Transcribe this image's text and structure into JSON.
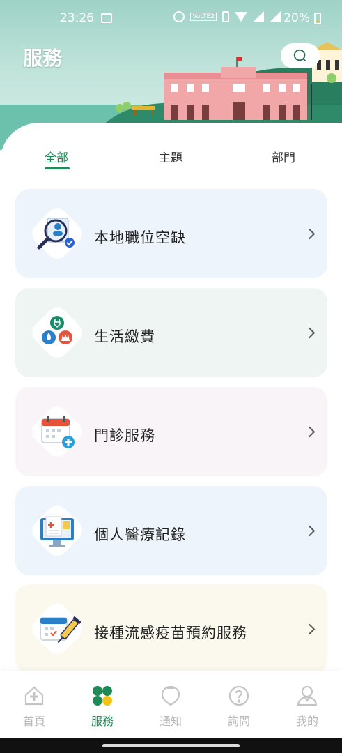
{
  "status_bar": {
    "time": "23:26",
    "battery": "20%",
    "volte": "VoLTE2"
  },
  "header": {
    "title": "服務",
    "search_icon": "search-icon"
  },
  "tabs": [
    {
      "label": "全部",
      "active": true
    },
    {
      "label": "主題",
      "active": false
    },
    {
      "label": "部門",
      "active": false
    }
  ],
  "services": [
    {
      "label": "本地職位空缺",
      "icon": "job-search-icon",
      "bg": "#eef4fb"
    },
    {
      "label": "生活繳費",
      "icon": "utility-bill-icon",
      "bg": "#eef5f3"
    },
    {
      "label": "門診服務",
      "icon": "clinic-calendar-icon",
      "bg": "#f8f4f8"
    },
    {
      "label": "個人醫療記錄",
      "icon": "medical-record-icon",
      "bg": "#eef4fb"
    },
    {
      "label": "接種流感疫苗預約服務",
      "icon": "vaccine-appointment-icon",
      "bg": "#fbf9ee"
    }
  ],
  "bottom_nav": [
    {
      "label": "首頁",
      "icon": "home-icon",
      "active": false
    },
    {
      "label": "服務",
      "icon": "services-icon",
      "active": true
    },
    {
      "label": "通知",
      "icon": "notification-icon",
      "active": false
    },
    {
      "label": "詢問",
      "icon": "help-icon",
      "active": false
    },
    {
      "label": "我的",
      "icon": "profile-icon",
      "active": false
    }
  ],
  "colors": {
    "accent": "#1f8a56",
    "inactive": "#b8b8b8"
  }
}
